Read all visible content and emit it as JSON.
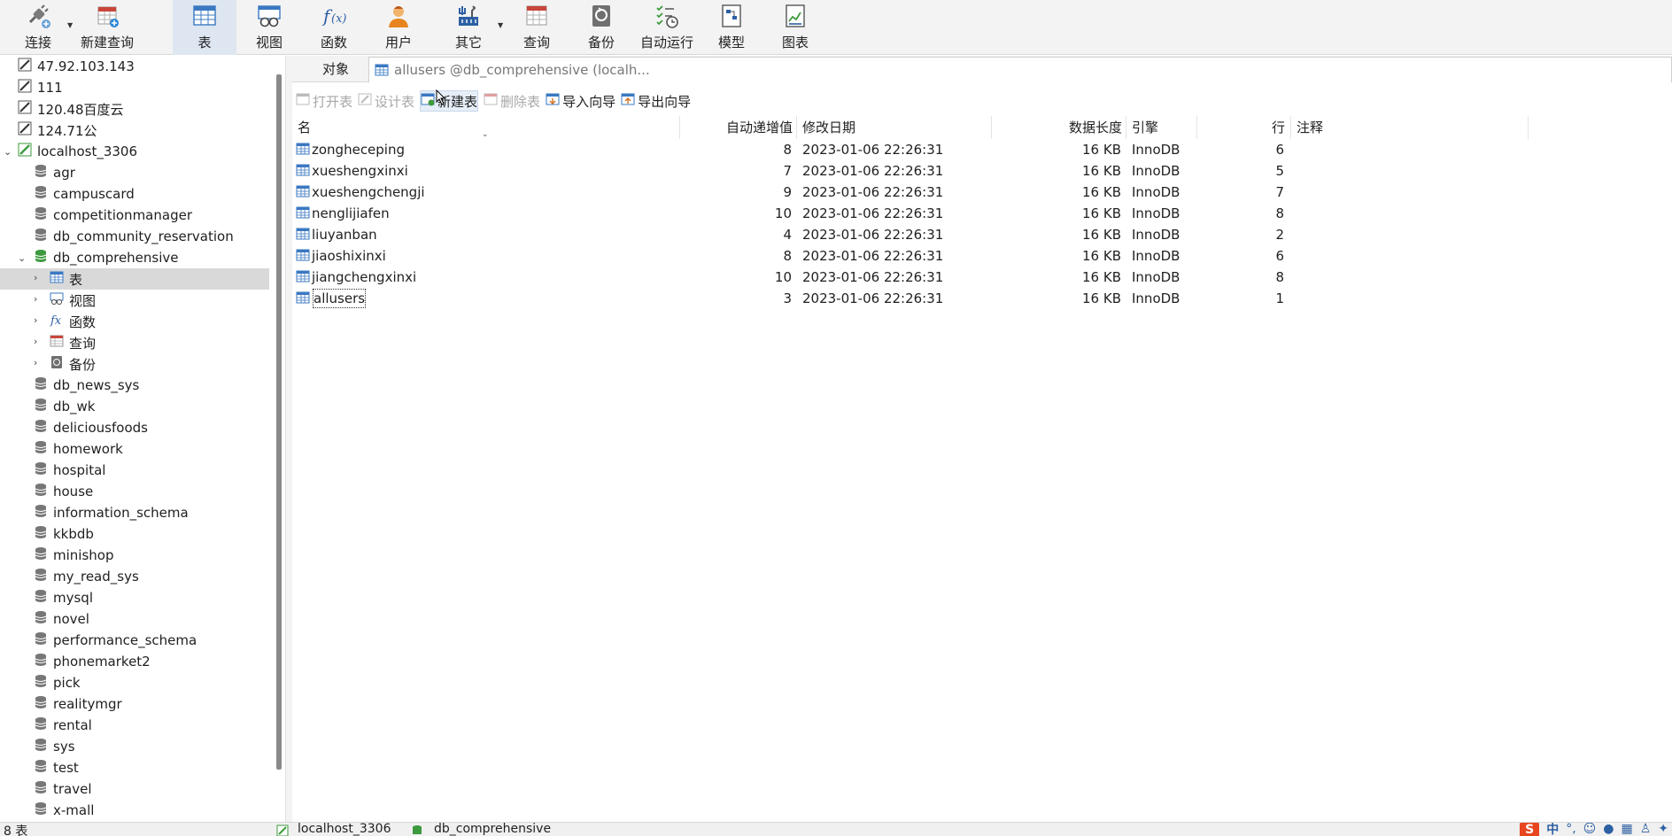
{
  "toolbar": {
    "buttons": [
      {
        "label": "连接",
        "icon": "plug-icon"
      },
      {
        "label": "新建查询",
        "icon": "new-query-icon"
      },
      {
        "label": "表",
        "icon": "table-icon"
      },
      {
        "label": "视图",
        "icon": "view-icon"
      },
      {
        "label": "函数",
        "icon": "function-icon"
      },
      {
        "label": "用户",
        "icon": "user-icon"
      },
      {
        "label": "其它",
        "icon": "tools-icon"
      },
      {
        "label": "查询",
        "icon": "query-icon"
      },
      {
        "label": "备份",
        "icon": "backup-icon"
      },
      {
        "label": "自动运行",
        "icon": "schedule-icon"
      },
      {
        "label": "模型",
        "icon": "model-icon"
      },
      {
        "label": "图表",
        "icon": "chart-icon"
      }
    ]
  },
  "sidebar": {
    "connections": [
      "47.92.103.143",
      "111",
      "120.48百度云",
      "124.71公",
      "localhost_3306"
    ],
    "databases_top": [
      "agr",
      "campuscard",
      "competitionmanager",
      "db_community_reservation",
      "db_comprehensive"
    ],
    "objects": [
      "表",
      "视图",
      "函数",
      "查询",
      "备份"
    ],
    "databases_bottom": [
      "db_news_sys",
      "db_wk",
      "deliciousfoods",
      "homework",
      "hospital",
      "house",
      "information_schema",
      "kkbdb",
      "minishop",
      "my_read_sys",
      "mysql",
      "novel",
      "performance_schema",
      "phonemarket2",
      "pick",
      "realitymgr",
      "rental",
      "sys",
      "test",
      "travel",
      "x-mall"
    ]
  },
  "tabs": {
    "objects": "对象",
    "document": "allusers @db_comprehensive (localh..."
  },
  "object_toolbar": {
    "open": "打开表",
    "design": "设计表",
    "new": "新建表",
    "delete": "删除表",
    "import": "导入向导",
    "export": "导出向导"
  },
  "table": {
    "columns": [
      "名",
      "自动递增值",
      "修改日期",
      "数据长度",
      "引擎",
      "行",
      "注释"
    ],
    "rows": [
      {
        "name": "zongheceping",
        "auto_inc": "8",
        "modified": "2023-01-06 22:26:31",
        "size": "16 KB",
        "engine": "InnoDB",
        "rows": "6"
      },
      {
        "name": "xueshengxinxi",
        "auto_inc": "7",
        "modified": "2023-01-06 22:26:31",
        "size": "16 KB",
        "engine": "InnoDB",
        "rows": "5"
      },
      {
        "name": "xueshengchengji",
        "auto_inc": "9",
        "modified": "2023-01-06 22:26:31",
        "size": "16 KB",
        "engine": "InnoDB",
        "rows": "7"
      },
      {
        "name": "nenglijiafen",
        "auto_inc": "10",
        "modified": "2023-01-06 22:26:31",
        "size": "16 KB",
        "engine": "InnoDB",
        "rows": "8"
      },
      {
        "name": "liuyanban",
        "auto_inc": "4",
        "modified": "2023-01-06 22:26:31",
        "size": "16 KB",
        "engine": "InnoDB",
        "rows": "2"
      },
      {
        "name": "jiaoshixinxi",
        "auto_inc": "8",
        "modified": "2023-01-06 22:26:31",
        "size": "16 KB",
        "engine": "InnoDB",
        "rows": "6"
      },
      {
        "name": "jiangchengxinxi",
        "auto_inc": "10",
        "modified": "2023-01-06 22:26:31",
        "size": "16 KB",
        "engine": "InnoDB",
        "rows": "8"
      },
      {
        "name": "allusers",
        "auto_inc": "3",
        "modified": "2023-01-06 22:26:31",
        "size": "16 KB",
        "engine": "InnoDB",
        "rows": "1"
      }
    ]
  },
  "status": {
    "count": "8 表",
    "connection": "localhost_3306",
    "database": "db_comprehensive"
  },
  "tray": {
    "ime_logo": "S",
    "ime_mode": "中"
  }
}
